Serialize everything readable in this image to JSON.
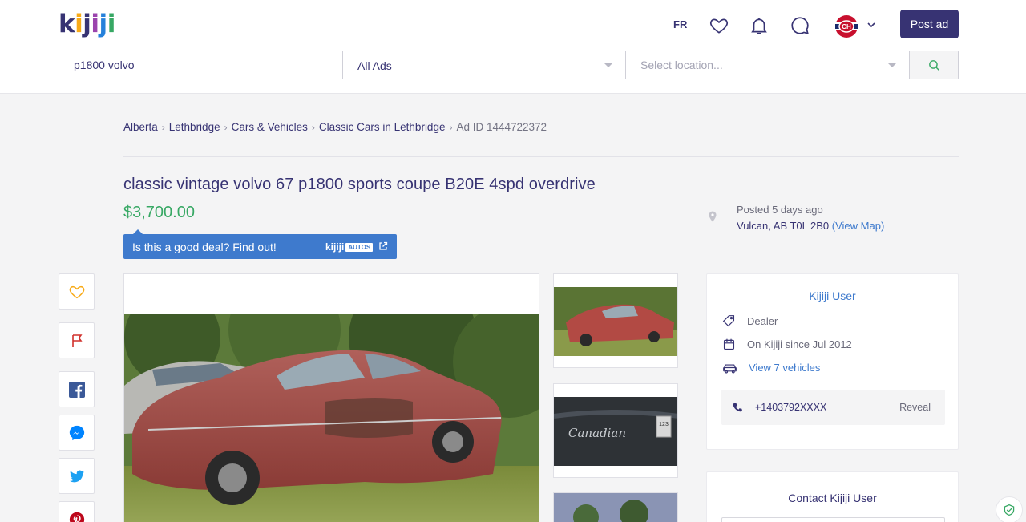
{
  "header": {
    "logo": "kijiji",
    "language": "FR",
    "post_ad_label": "Post ad",
    "icons": [
      "heart-icon",
      "bell-icon",
      "chat-icon",
      "avatar",
      "chevron-down-icon"
    ]
  },
  "search": {
    "query": "p1800 volvo",
    "category": "All Ads",
    "location_placeholder": "Select location..."
  },
  "breadcrumb": {
    "items": [
      "Alberta",
      "Lethbridge",
      "Cars & Vehicles",
      "Classic Cars in Lethbridge"
    ],
    "ad_id": "Ad ID 1444722372"
  },
  "listing": {
    "title": "classic vintage volvo 67 p1800 sports coupe B20E 4spd overdrive",
    "price": "$3,700.00",
    "deal_text": "Is this a good deal? Find out!",
    "deal_brand": "kijiji",
    "deal_brand_sub": "AUTOS",
    "posted": "Posted 5 days ago",
    "location": "Vulcan, AB T0L 2B0",
    "view_map": "(View Map)"
  },
  "seller": {
    "name": "Kijiji User",
    "type": "Dealer",
    "since": "On Kijiji since Jul 2012",
    "vehicles_link": "View 7 vehicles",
    "phone": "+1403792XXXX",
    "reveal": "Reveal"
  },
  "contact": {
    "title": "Contact Kijiji User"
  },
  "colors": {
    "brand_dark": "#373373",
    "price_green": "#37a864",
    "link_blue": "#3e7acd"
  }
}
